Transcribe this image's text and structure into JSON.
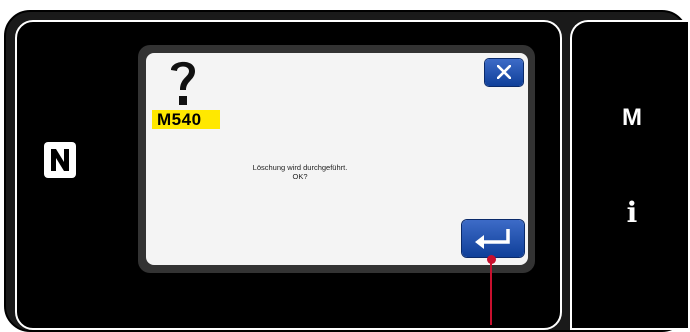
{
  "dialog": {
    "error_code": "M540",
    "message_line1": "Löschung wird durchgeführt.",
    "message_line2": "OK?"
  },
  "side_panel": {
    "mode_label": "M",
    "info_label": "i"
  },
  "icons": {
    "status": "question-mark-icon",
    "close": "close-icon",
    "enter": "enter-icon",
    "nfc": "nfc-icon"
  },
  "colors": {
    "accent": "#0f3f99",
    "badge": "#ffe800",
    "callout": "#c8102e"
  }
}
